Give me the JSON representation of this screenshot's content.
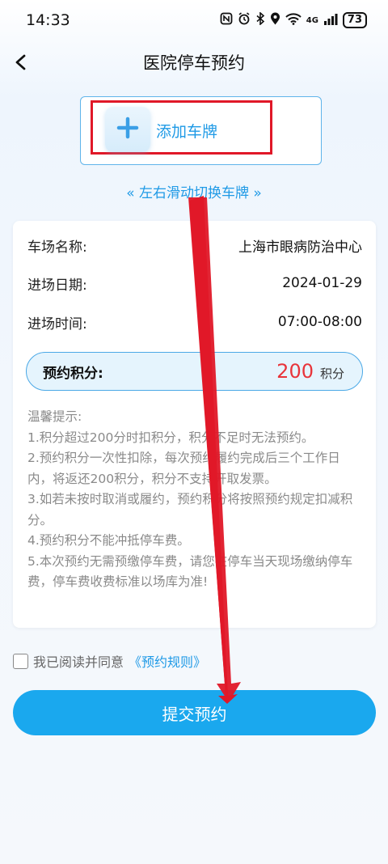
{
  "status_bar": {
    "time": "14:33",
    "network": "4G",
    "battery": "73"
  },
  "nav": {
    "title": "医院停车预约"
  },
  "plate": {
    "add_label": "添加车牌",
    "swipe_hint": "« 左右滑动切换车牌 »"
  },
  "info": {
    "rows": [
      {
        "label": "车场名称:",
        "value": "上海市眼病防治中心"
      },
      {
        "label": "进场日期:",
        "value": "2024-01-29"
      },
      {
        "label": "进场时间:",
        "value": "07:00-08:00"
      }
    ],
    "points": {
      "label": "预约积分:",
      "value": "200",
      "unit": "积分"
    }
  },
  "tips": {
    "title": "温馨提示:",
    "lines": [
      "1.积分超过200分时扣积分，积分不足时无法预约。",
      "2.预约积分一次性扣除，每次预约履约完成后三个工作日内，将返还200积分，积分不支持开取发票。",
      "3.如若未按时取消或履约，预约积分将按照预约规定扣减积分。",
      "4.预约积分不能冲抵停车费。",
      "5.本次预约无需预缴停车费，请您在停车当天现场缴纳停车费，停车费收费标准以场库为准!"
    ]
  },
  "agreement": {
    "text": "我已阅读并同意",
    "link": "《预约规则》"
  },
  "submit": {
    "label": "提交预约"
  },
  "colors": {
    "accent": "#1aa8ee",
    "link": "#1f9ae6",
    "points": "#e8343a",
    "annotation": "#e01828"
  }
}
